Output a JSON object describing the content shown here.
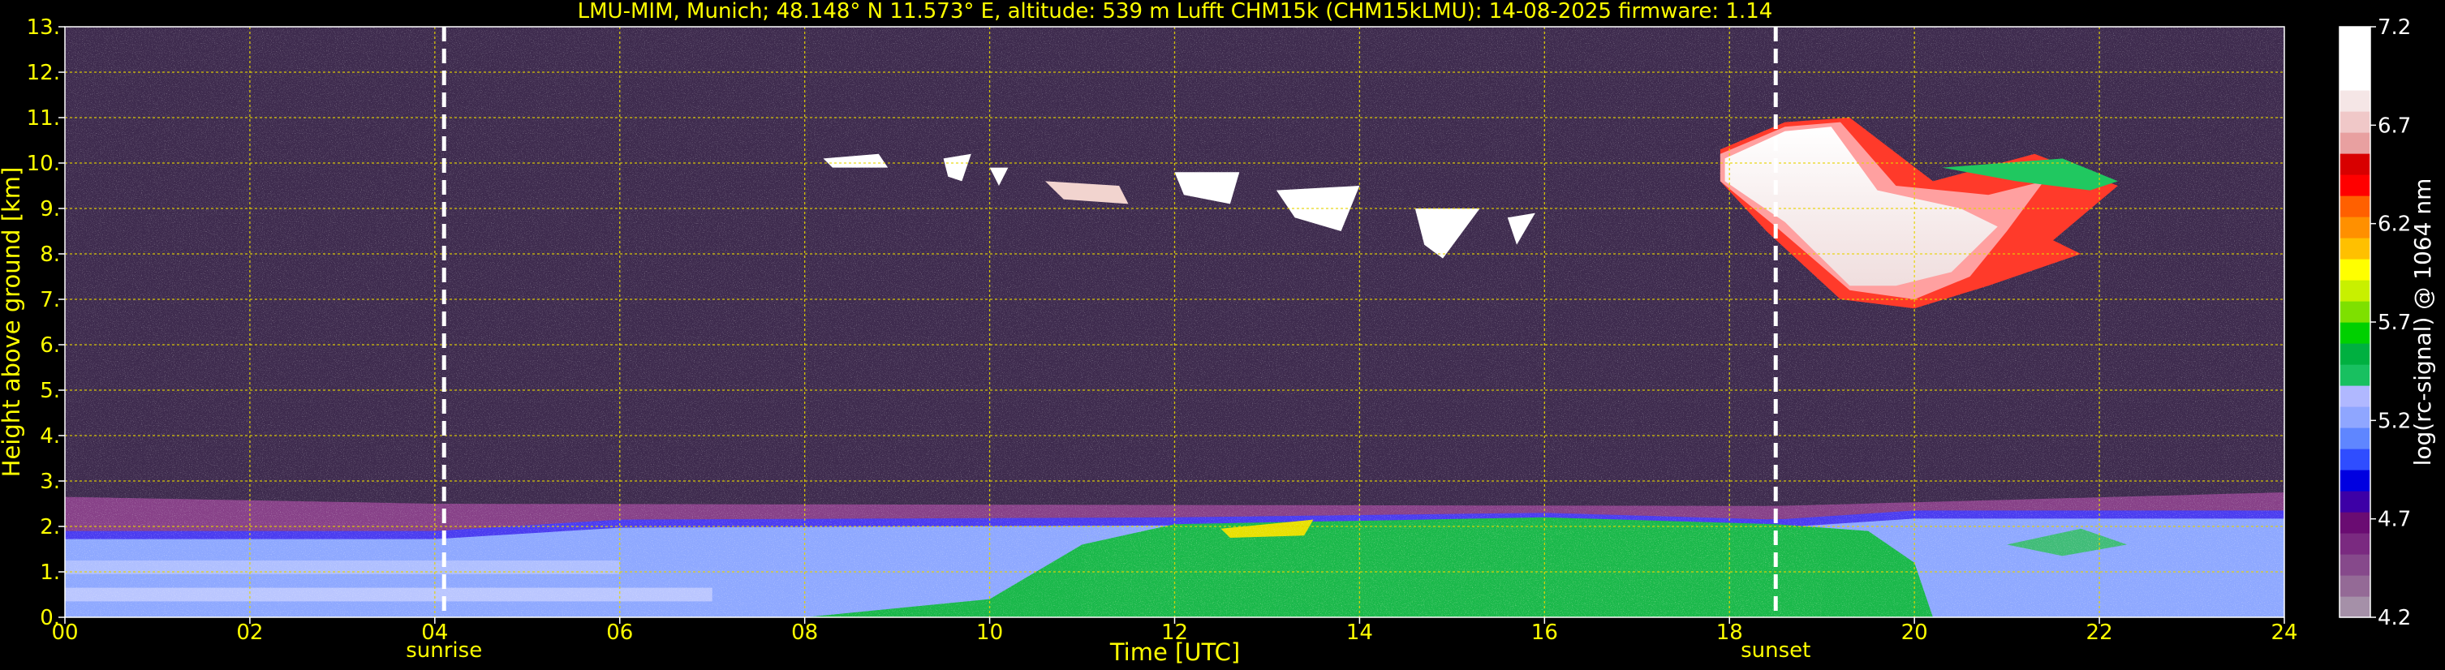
{
  "chart_data": {
    "type": "heatmap",
    "title": "LMU-MIM, Munich; 48.148° N 11.573° E, altitude: 539 m     Lufft CHM15k (CHM15kLMU): 14-08-2025     firmware: 1.14",
    "xlabel": "Time [UTC]",
    "ylabel": "Height above ground [km]",
    "xlim": [
      0,
      24
    ],
    "ylim": [
      0,
      13
    ],
    "x_ticks": [
      "00",
      "02",
      "04",
      "06",
      "08",
      "10",
      "12",
      "14",
      "16",
      "18",
      "20",
      "22",
      "24"
    ],
    "y_ticks": [
      "0.",
      "1.",
      "2.",
      "3.",
      "4.",
      "5.",
      "6.",
      "7.",
      "8.",
      "9.",
      "10.",
      "11.",
      "12.",
      "13."
    ],
    "grid": true,
    "events": [
      {
        "label": "sunrise",
        "time": 4.1
      },
      {
        "label": "sunset",
        "time": 18.5
      }
    ],
    "colorbar": {
      "label": "log(rc-signal) @ 1064 nm",
      "range": [
        4.2,
        7.2
      ],
      "ticks": [
        "4.2",
        "4.7",
        "5.2",
        "5.7",
        "6.2",
        "6.7",
        "7.2"
      ],
      "colors": [
        "#a590a8",
        "#946a96",
        "#86498b",
        "#7a2a80",
        "#6a0c72",
        "#3d00a6",
        "#0000e0",
        "#2f4dff",
        "#5f86ff",
        "#8fa6ff",
        "#b0b8ff",
        "#18c060",
        "#00b040",
        "#00d000",
        "#7ee000",
        "#c8f000",
        "#ffff00",
        "#ffc000",
        "#ff9000",
        "#ff6000",
        "#ff0000",
        "#d80000",
        "#e8a0a0",
        "#f0c8c8",
        "#f5e6e6",
        "#ffffff",
        "#ffffff",
        "#ffffff"
      ]
    },
    "layers": {
      "boundary_layer_top": [
        [
          0,
          1.9
        ],
        [
          4,
          1.9
        ],
        [
          6,
          2.15
        ],
        [
          12,
          2.2
        ],
        [
          16,
          2.3
        ],
        [
          18.5,
          2.15
        ],
        [
          20,
          2.35
        ],
        [
          24,
          2.35
        ]
      ],
      "residual_layer_top": [
        [
          0,
          2.65
        ],
        [
          4,
          2.5
        ],
        [
          18.5,
          2.45
        ],
        [
          24,
          2.75
        ]
      ],
      "mixed_layer_green_start": 8.0,
      "cirrus_cloud_hours": [
        8.2,
        22.2
      ],
      "cirrus_main": {
        "start_hour": 17.9,
        "end_hour": 22.2,
        "base_km": 6.7,
        "top_km": 11.1
      }
    }
  }
}
